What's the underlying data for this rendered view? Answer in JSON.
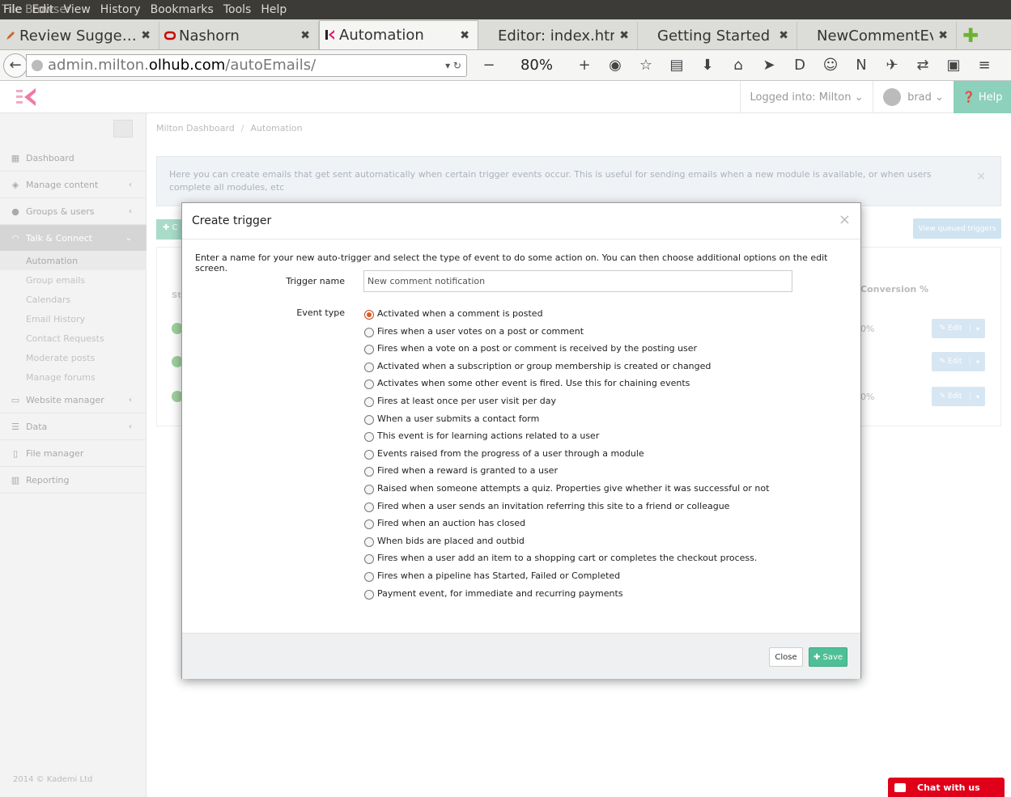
{
  "menubar": {
    "items": [
      "File",
      "Edit",
      "View",
      "History",
      "Bookmarks",
      "Tools",
      "Help"
    ],
    "overlap_title": "Tile Browser"
  },
  "tabs": [
    {
      "label": "Review Sugge…",
      "active": false
    },
    {
      "label": "Nashorn",
      "active": false
    },
    {
      "label": "Automation",
      "active": true
    },
    {
      "label": "Editor: index.html",
      "active": false
    },
    {
      "label": "Getting Started",
      "active": false
    },
    {
      "label": "NewCommentEv…",
      "active": false
    }
  ],
  "url": {
    "prefix": "admin.milton.",
    "host": "olhub.com",
    "path": "/autoEmails/"
  },
  "zoom": "80%",
  "header": {
    "logged_into": "Logged into: Milton",
    "user": "brad",
    "help": "Help"
  },
  "sidebar": {
    "items": [
      {
        "label": "Dashboard",
        "icon": "grid-icon"
      },
      {
        "label": "Manage content",
        "icon": "layers-icon"
      },
      {
        "label": "Groups & users",
        "icon": "user-icon"
      },
      {
        "label": "Talk & Connect",
        "icon": "wifi-icon"
      },
      {
        "label": "Website manager",
        "icon": "laptop-icon"
      },
      {
        "label": "Data",
        "icon": "database-icon"
      },
      {
        "label": "File manager",
        "icon": "file-icon"
      },
      {
        "label": "Reporting",
        "icon": "bar-chart-icon"
      }
    ],
    "subitems": [
      "Automation",
      "Group emails",
      "Calendars",
      "Email History",
      "Contact Requests",
      "Moderate posts",
      "Manage forums"
    ]
  },
  "breadcrumb": [
    "Milton Dashboard",
    "Automation"
  ],
  "info_text": "Here you can create emails that get sent automatically when certain trigger events occur. This is useful for sending emails when a new module is available, or when users complete all modules, etc",
  "view_queued": "View queued triggers",
  "table": {
    "conversion_header": "Conversion %",
    "rows": [
      {
        "pct": "0%"
      },
      {
        "pct": ""
      },
      {
        "pct": "0%"
      }
    ],
    "edit_label": "Edit"
  },
  "modal": {
    "title": "Create trigger",
    "intro": "Enter a name for your new auto-trigger and select the type of event to do some action on. You can then choose additional options on the edit screen.",
    "trigger_name_label": "Trigger name",
    "trigger_name_value": "New comment notification",
    "event_type_label": "Event type",
    "events": [
      "Activated when a comment is posted",
      "Fires when a user votes on a post or comment",
      "Fires when a vote on a post or comment is received by the posting user",
      "Activated when a subscription or group membership is created or changed",
      "Activates when some other event is fired. Use this for chaining events",
      "Fires at least once per user visit per day",
      "When a user submits a contact form",
      "This event is for learning actions related to a user",
      "Events raised from the progress of a user through a module",
      "Fired when a reward is granted to a user",
      "Raised when someone attempts a quiz. Properties give whether it was successful or not",
      "Fired when a user sends an invitation referring this site to a friend or colleague",
      "Fired when an auction has closed",
      "When bids are placed and outbid",
      "Fires when a user add an item to a shopping cart or completes the checkout process.",
      "Fires when a pipeline has Started, Failed or Completed",
      "Payment event, for immediate and recurring payments"
    ],
    "selected_index": 0,
    "close_label": "Close",
    "save_label": "Save"
  },
  "footer": "2014 © Kademi Ltd",
  "chat_label": "Chat with us"
}
